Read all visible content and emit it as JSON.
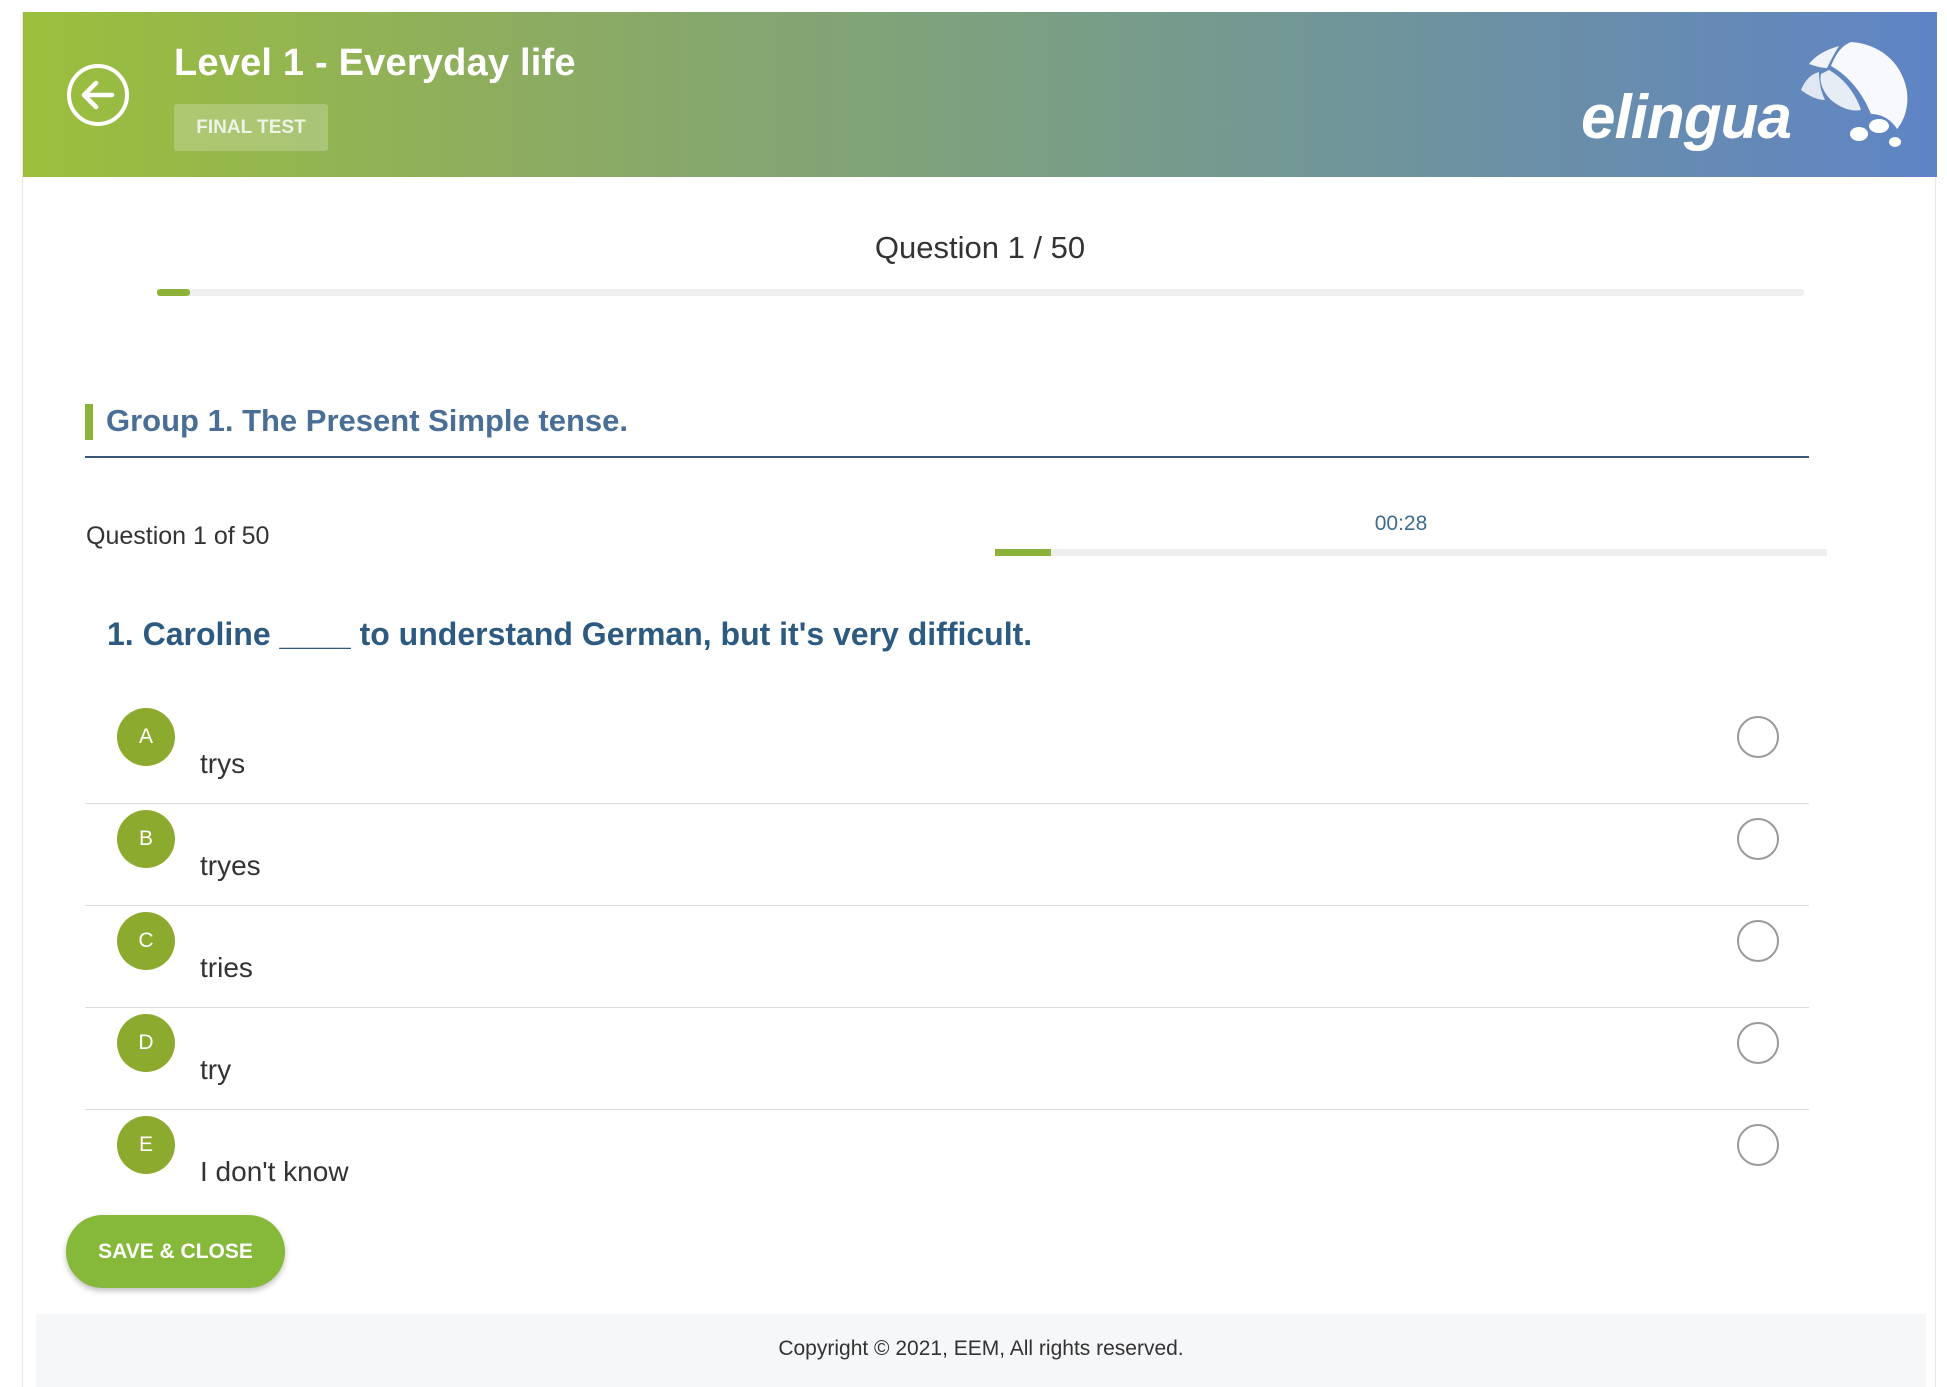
{
  "header": {
    "title": "Level 1 - Everyday life",
    "badge": "FINAL TEST",
    "logo_text": "elingua",
    "colors": {
      "gradient_start": "#9bbf3c",
      "gradient_end": "#5f84c6"
    }
  },
  "progress": {
    "heading": "Question 1 / 50",
    "current": 1,
    "total": 50
  },
  "group": {
    "title": "Group 1. The Present Simple tense."
  },
  "question": {
    "counter": "Question 1 of 50",
    "timer": "00:28",
    "timer_fraction": 0.067,
    "text": "1. Caroline ____ to understand German, but it's very difficult."
  },
  "answers": [
    {
      "letter": "A",
      "text": "trys",
      "selected": false
    },
    {
      "letter": "B",
      "text": "tryes",
      "selected": false
    },
    {
      "letter": "C",
      "text": "tries",
      "selected": false
    },
    {
      "letter": "D",
      "text": "try",
      "selected": false
    },
    {
      "letter": "E",
      "text": "I don't know",
      "selected": false
    }
  ],
  "actions": {
    "save_label": "SAVE & CLOSE"
  },
  "footer": {
    "copyright": "Copyright © 2021, EEM, All rights reserved."
  },
  "colors": {
    "accent": "#8cb23a",
    "heading_blue": "#4a6f96",
    "question_blue": "#2c5a80"
  }
}
